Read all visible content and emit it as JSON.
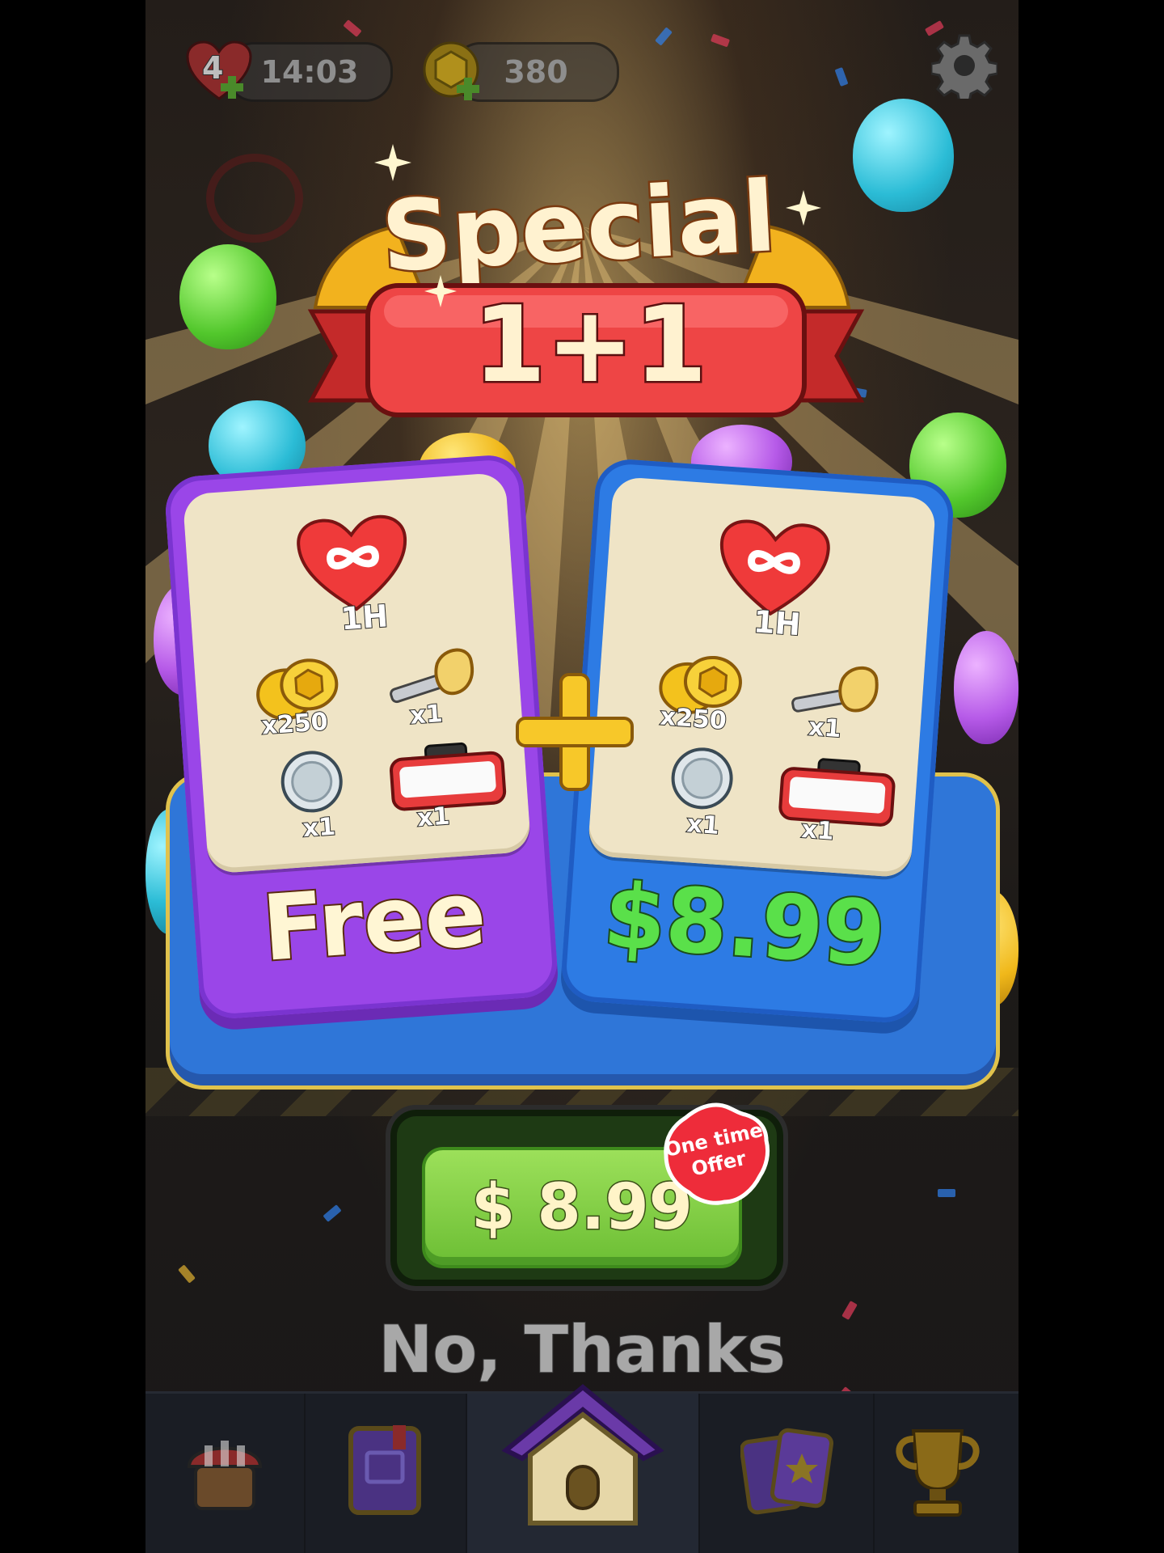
{
  "hud": {
    "lives": "4",
    "timer": "14:03",
    "coins": "380"
  },
  "popup": {
    "title_top": "Special",
    "title_main": "1+1",
    "free_card": {
      "heart_label": "1H",
      "coins_qty": "x250",
      "hammer_qty": "x1",
      "ring_qty": "x1",
      "toolbox_qty": "x1",
      "price": "Free"
    },
    "paid_card": {
      "heart_label": "1H",
      "coins_qty": "x250",
      "hammer_qty": "x1",
      "ring_qty": "x1",
      "toolbox_qty": "x1",
      "price": "$8.99"
    },
    "buy_button": "$ 8.99",
    "badge_line1": "One time",
    "badge_line2": "Offer",
    "decline": "No, Thanks"
  },
  "icons": {
    "settings": "gear-icon",
    "nav": [
      "shop-icon",
      "album-icon",
      "home-icon",
      "cards-icon",
      "trophy-icon"
    ]
  },
  "colors": {
    "free_card": "#9a46e8",
    "paid_card": "#2d7be4",
    "price_green": "#5ae04a",
    "buy_button": "#7cc840",
    "ribbon_red": "#e83c3c"
  }
}
